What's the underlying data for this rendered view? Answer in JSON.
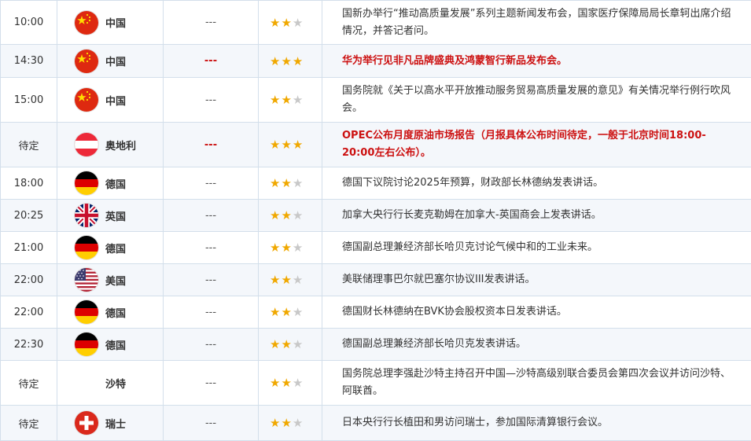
{
  "colors": {
    "highlight": "#cc1111",
    "star": "#f0a800",
    "border": "#d3dfeb"
  },
  "rows": [
    {
      "time": "10:00",
      "country": "中国",
      "flag": "cn-flag-icon",
      "actual": "---",
      "stars": 2,
      "highlight": false,
      "event": "国新办举行“推动高质量发展”系列主题新闻发布会，国家医疗保障局局长章轲出席介绍情况，并答记者问。"
    },
    {
      "time": "14:30",
      "country": "中国",
      "flag": "cn-flag-icon",
      "actual": "---",
      "stars": 3,
      "highlight": true,
      "event": "华为举行见非凡品牌盛典及鸿蒙智行新品发布会。"
    },
    {
      "time": "15:00",
      "country": "中国",
      "flag": "cn-flag-icon",
      "actual": "---",
      "stars": 2,
      "highlight": false,
      "event": "国务院就《关于以高水平开放推动服务贸易高质量发展的意见》有关情况举行例行吹风会。"
    },
    {
      "time": "待定",
      "country": "奥地利",
      "flag": "at-flag-icon",
      "actual": "---",
      "stars": 3,
      "highlight": true,
      "event": "OPEC公布月度原油市场报告（月报具体公布时间待定，一般于北京时间18:00-20:00左右公布）。"
    },
    {
      "time": "18:00",
      "country": "德国",
      "flag": "de-flag-icon",
      "actual": "---",
      "stars": 2,
      "highlight": false,
      "event": "德国下议院讨论2025年预算，财政部长林德纳发表讲话。"
    },
    {
      "time": "20:25",
      "country": "英国",
      "flag": "uk-flag-icon",
      "actual": "---",
      "stars": 2,
      "highlight": false,
      "event": "加拿大央行行长麦克勒姆在加拿大-英国商会上发表讲话。"
    },
    {
      "time": "21:00",
      "country": "德国",
      "flag": "de-flag-icon",
      "actual": "---",
      "stars": 2,
      "highlight": false,
      "event": "德国副总理兼经济部长哈贝克讨论气候中和的工业未来。"
    },
    {
      "time": "22:00",
      "country": "美国",
      "flag": "us-flag-icon",
      "actual": "---",
      "stars": 2,
      "highlight": false,
      "event": "美联储理事巴尔就巴塞尔协议III发表讲话。"
    },
    {
      "time": "22:00",
      "country": "德国",
      "flag": "de-flag-icon",
      "actual": "---",
      "stars": 2,
      "highlight": false,
      "event": "德国财长林德纳在BVK协会股权资本日发表讲话。"
    },
    {
      "time": "22:30",
      "country": "德国",
      "flag": "de-flag-icon",
      "actual": "---",
      "stars": 2,
      "highlight": false,
      "event": "德国副总理兼经济部长哈贝克发表讲话。"
    },
    {
      "time": "待定",
      "country": "沙特",
      "flag": "",
      "actual": "---",
      "stars": 2,
      "highlight": false,
      "event": "国务院总理李强赴沙特主持召开中国—沙特高级别联合委员会第四次会议并访问沙特、阿联酋。"
    },
    {
      "time": "待定",
      "country": "瑞士",
      "flag": "ch-flag-icon",
      "actual": "---",
      "stars": 2,
      "highlight": false,
      "event": "日本央行行长植田和男访问瑞士，参加国际清算银行会议。"
    }
  ]
}
